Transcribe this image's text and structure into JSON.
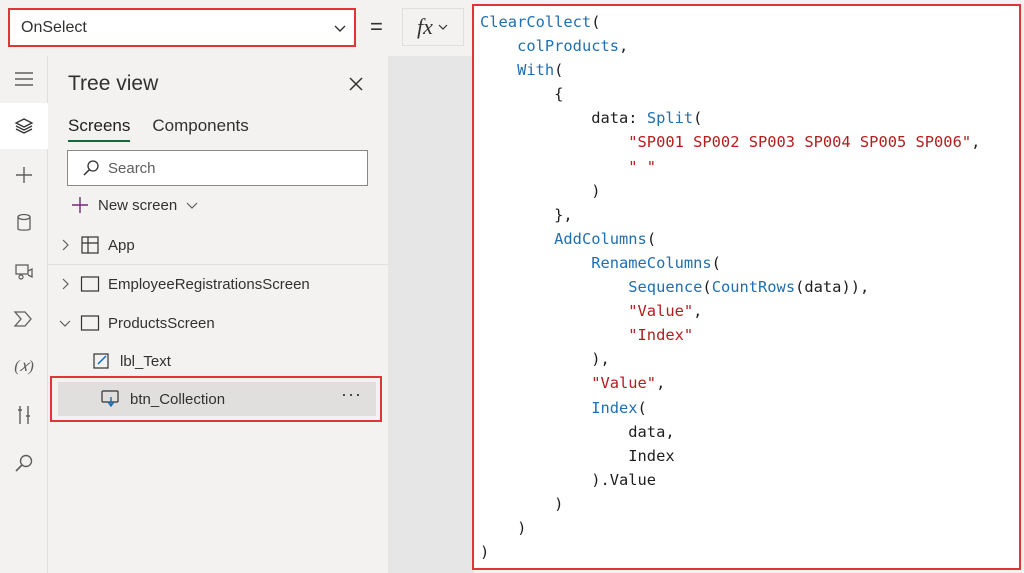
{
  "formula_bar": {
    "property": "OnSelect",
    "equals": "=",
    "fx_label": "fx"
  },
  "tree_view": {
    "title": "Tree view",
    "tabs": [
      {
        "label": "Screens",
        "active": true
      },
      {
        "label": "Components",
        "active": false
      }
    ],
    "search_placeholder": "Search",
    "new_screen_label": "New screen",
    "nodes": [
      {
        "label": "App",
        "icon": "app-icon"
      },
      {
        "label": "EmployeeRegistrationsScreen",
        "icon": "screen-icon"
      },
      {
        "label": "ProductsScreen",
        "icon": "screen-icon"
      },
      {
        "label": "lbl_Text",
        "icon": "label-icon"
      },
      {
        "label": "btn_Collection",
        "icon": "button-icon",
        "selected": true
      }
    ],
    "more_label": "···"
  },
  "rail": [
    "hamburger-icon",
    "layers-icon",
    "plus-icon",
    "database-icon",
    "media-icon",
    "power-automate-icon",
    "variables-icon",
    "tools-icon",
    "search-icon"
  ],
  "code": {
    "lines": [
      "ClearCollect(",
      "    colProducts,",
      "    With(",
      "        {",
      "            data: Split(",
      "                \"SP001 SP002 SP003 SP004 SP005 SP006\",",
      "                \" \"",
      "            )",
      "        },",
      "        AddColumns(",
      "            RenameColumns(",
      "                Sequence(CountRows(data)),",
      "                \"Value\",",
      "                \"Index\"",
      "            ),",
      "            \"Value\",",
      "            Index(",
      "                data,",
      "                Index",
      "            ).Value",
      "        )",
      "    )",
      ")"
    ]
  },
  "colors": {
    "highlight_border": "#e0333a",
    "function": "#1f6fb2",
    "string": "#b31d1d",
    "accent_tab": "#0f6b3e"
  }
}
